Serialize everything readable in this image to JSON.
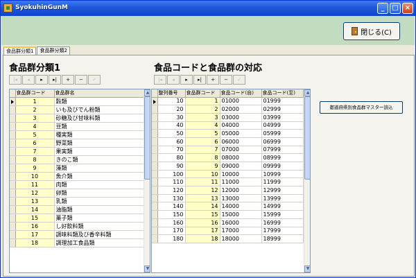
{
  "window": {
    "title": "SyokuhinGunM"
  },
  "toolbar": {
    "close_label": "閉じる(C)"
  },
  "tabs": [
    {
      "label": "食品群分類1",
      "active": true
    },
    {
      "label": "食品群分類2",
      "active": false
    }
  ],
  "left": {
    "heading": "食品群分類1",
    "columns": [
      "食品群コード",
      "食品群名"
    ],
    "rows": [
      [
        "1",
        "穀類"
      ],
      [
        "2",
        "いも及びでん粉類"
      ],
      [
        "3",
        "砂糖及び甘味料類"
      ],
      [
        "4",
        "豆類"
      ],
      [
        "5",
        "種実類"
      ],
      [
        "6",
        "野菜類"
      ],
      [
        "7",
        "果実類"
      ],
      [
        "8",
        "きのこ類"
      ],
      [
        "9",
        "藻類"
      ],
      [
        "10",
        "魚介類"
      ],
      [
        "11",
        "肉類"
      ],
      [
        "12",
        "卵類"
      ],
      [
        "13",
        "乳類"
      ],
      [
        "14",
        "油脂類"
      ],
      [
        "15",
        "菓子類"
      ],
      [
        "16",
        "し好飲料類"
      ],
      [
        "17",
        "調味料類及び香辛料類"
      ],
      [
        "18",
        "調理加工食品類"
      ]
    ]
  },
  "right": {
    "heading": "食品コードと食品群の対応",
    "columns": [
      "整列番号",
      "食品群コード",
      "食品コード(自)",
      "食品コード(至)"
    ],
    "rows": [
      [
        "10",
        "1",
        "01000",
        "01999"
      ],
      [
        "20",
        "2",
        "02000",
        "02999"
      ],
      [
        "30",
        "3",
        "03000",
        "03999"
      ],
      [
        "40",
        "4",
        "04000",
        "04999"
      ],
      [
        "50",
        "5",
        "05000",
        "05999"
      ],
      [
        "60",
        "6",
        "06000",
        "06999"
      ],
      [
        "70",
        "7",
        "07000",
        "07999"
      ],
      [
        "80",
        "8",
        "08000",
        "08999"
      ],
      [
        "90",
        "9",
        "09000",
        "09999"
      ],
      [
        "100",
        "10",
        "10000",
        "10999"
      ],
      [
        "110",
        "11",
        "11000",
        "11999"
      ],
      [
        "120",
        "12",
        "12000",
        "12999"
      ],
      [
        "130",
        "13",
        "13000",
        "13999"
      ],
      [
        "140",
        "14",
        "14000",
        "14999"
      ],
      [
        "150",
        "15",
        "15000",
        "15999"
      ],
      [
        "160",
        "16",
        "16000",
        "16999"
      ],
      [
        "170",
        "17",
        "17000",
        "17999"
      ],
      [
        "180",
        "18",
        "18000",
        "18999"
      ]
    ]
  },
  "master_button": {
    "label": "都道府県別食品群マスター読込"
  },
  "nav_icons": [
    "first-icon",
    "prev-icon",
    "next-icon",
    "last-icon",
    "add-icon",
    "delete-icon",
    "confirm-icon"
  ],
  "nav_glyphs": [
    "|◂",
    "◂",
    "▸",
    "▸|",
    "+",
    "−",
    "✓"
  ],
  "title_buttons": {
    "minimize": "_",
    "maximize": "□",
    "close": "×"
  },
  "scroll_glyphs": {
    "up": "▲",
    "down": "▼"
  },
  "colors": {
    "titlebar": "#1f57d6",
    "band": "#c1dcc1",
    "cell_highlight": "#ffffc8"
  }
}
